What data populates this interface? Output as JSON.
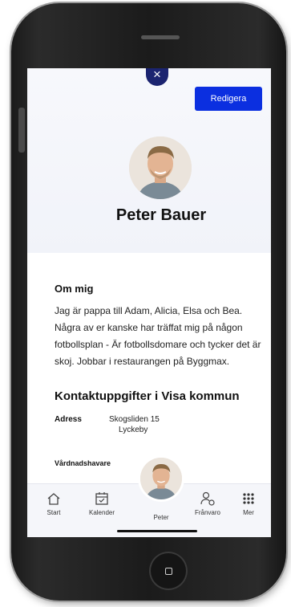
{
  "profile": {
    "edit_label": "Redigera",
    "name": "Peter Bauer"
  },
  "about": {
    "title": "Om mig",
    "text": "Jag är pappa till Adam, Alicia, Elsa och Bea. Några av er kanske har träffat mig på någon fotbollsplan - Är fotbollsdomare och tycker det är skoj. Jobbar i restaurangen på Byggmax."
  },
  "contact": {
    "title": "Kontaktuppgifter i Visa kommun",
    "address_label": "Adress",
    "address_line1": "Skogsliden 15",
    "address_line2": "Lyckeby",
    "guardian_label": "Vårdnadshavare"
  },
  "tabbar": {
    "start": "Start",
    "calendar": "Kalender",
    "peter": "Peter",
    "absence": "Frånvaro",
    "more": "Mer"
  },
  "colors": {
    "accent": "#0b2fe0",
    "close_button": "#1b2470",
    "hero_background": "#f3f5fa"
  },
  "icons": {
    "close": "close-icon",
    "start": "home-icon",
    "calendar": "calendar-icon",
    "absence": "person-absence-icon",
    "more": "grid-dots-icon"
  }
}
